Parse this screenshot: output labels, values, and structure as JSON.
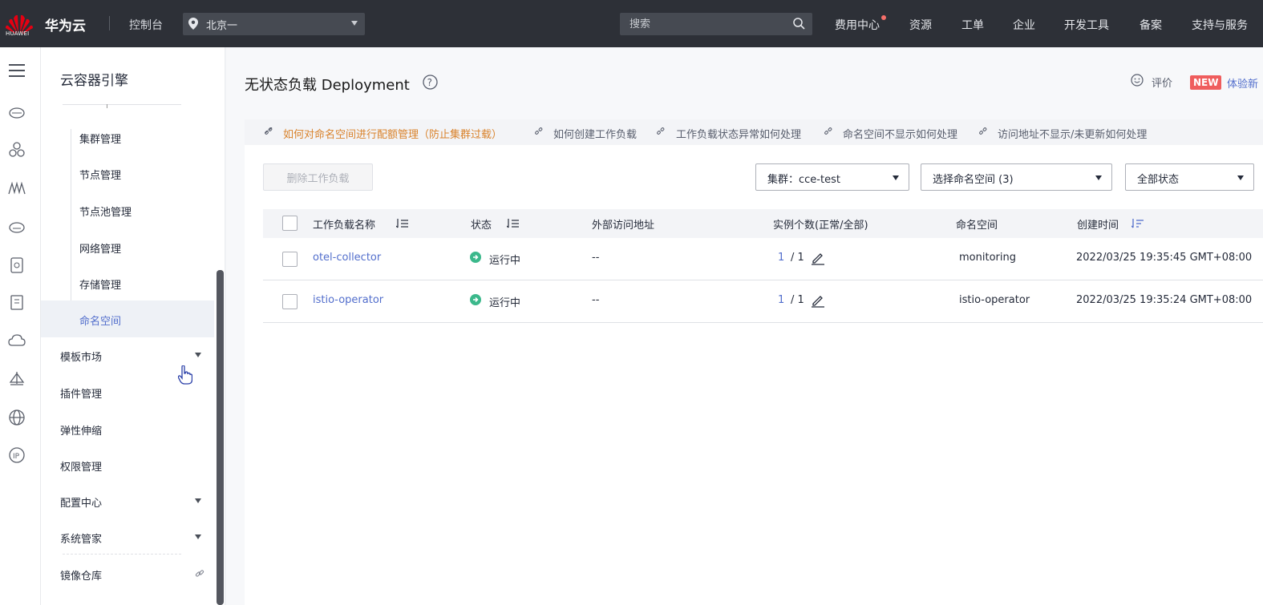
{
  "header": {
    "logo_text": "HUAWEI",
    "brand": "华为云",
    "console": "控制台",
    "region": "北京一",
    "search_placeholder": "搜索",
    "nav": [
      "费用中心",
      "资源",
      "工单",
      "企业",
      "开发工具",
      "备案",
      "支持与服务"
    ]
  },
  "sidebar": {
    "title": "云容器引擎",
    "sub_items": [
      "集群管理",
      "节点管理",
      "节点池管理",
      "网络管理",
      "存储管理",
      "命名空间"
    ],
    "active": "命名空间",
    "items": [
      {
        "label": "模板市场",
        "expandable": true
      },
      {
        "label": "插件管理",
        "expandable": false
      },
      {
        "label": "弹性伸缩",
        "expandable": false
      },
      {
        "label": "权限管理",
        "expandable": false
      },
      {
        "label": "配置中心",
        "expandable": true
      },
      {
        "label": "系统管家",
        "expandable": true
      },
      {
        "label": "镜像仓库",
        "expandable": false,
        "external": true
      }
    ]
  },
  "page": {
    "title": "无状态负载 Deployment",
    "rate": "评价",
    "new_badge": "NEW",
    "new_text": "体验新"
  },
  "tips": [
    "如何对命名空间进行配额管理（防止集群过载）",
    "如何创建工作负载",
    "工作负载状态异常如何处理",
    "命名空间不显示如何处理",
    "访问地址不显示/未更新如何处理"
  ],
  "toolbar": {
    "delete_label": "删除工作负载",
    "cluster_select": "集群：cce-test",
    "namespace_select": "选择命名空间 (3)",
    "status_select": "全部状态"
  },
  "table": {
    "columns": [
      "工作负载名称",
      "状态",
      "外部访问地址",
      "实例个数(正常/全部)",
      "命名空间",
      "创建时间"
    ],
    "rows": [
      {
        "name": "otel-collector",
        "status": "运行中",
        "address": "--",
        "inst_normal": "1",
        "inst_total": "/ 1",
        "namespace": "monitoring",
        "created": "2022/03/25 19:35:45 GMT+08:00"
      },
      {
        "name": "istio-operator",
        "status": "运行中",
        "address": "--",
        "inst_normal": "1",
        "inst_total": "/ 1",
        "namespace": "istio-operator",
        "created": "2022/03/25 19:35:24 GMT+08:00"
      }
    ]
  },
  "colors": {
    "topbar": "#2d3037",
    "link": "#526ecc",
    "warn": "#d9822b",
    "running": "#3bb88b",
    "new_badge": "#ef5d5d"
  }
}
